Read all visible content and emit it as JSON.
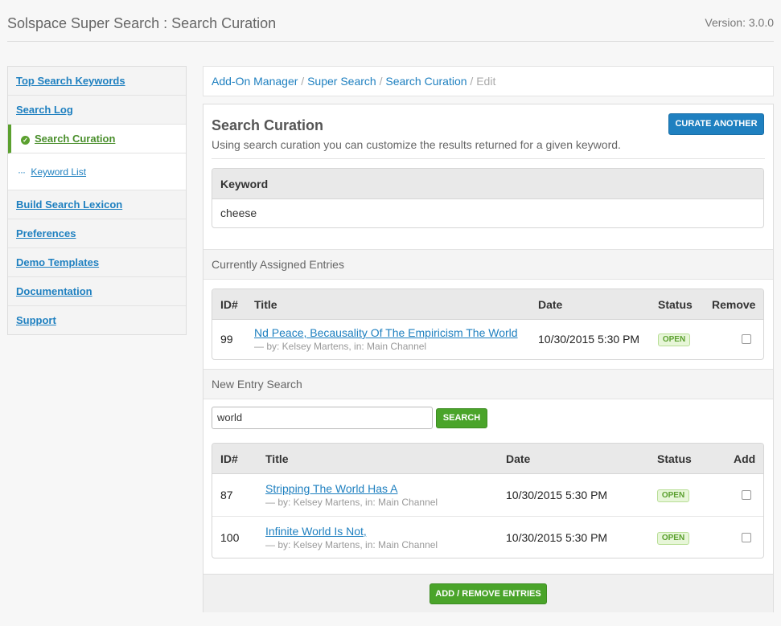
{
  "header": {
    "title": "Solspace Super Search : Search Curation",
    "version": "Version: 3.0.0"
  },
  "sidebar": {
    "items": [
      {
        "label": "Top Search Keywords"
      },
      {
        "label": "Search Log"
      },
      {
        "label": "Search Curation",
        "active": true
      },
      {
        "label": "Keyword List",
        "sub": true
      },
      {
        "label": "Build Search Lexicon"
      },
      {
        "label": "Preferences"
      },
      {
        "label": "Demo Templates"
      },
      {
        "label": "Documentation"
      },
      {
        "label": "Support"
      }
    ]
  },
  "breadcrumb": {
    "items": [
      "Add-On Manager",
      "Super Search",
      "Search Curation"
    ],
    "separator": "/",
    "current": "Edit"
  },
  "main": {
    "title": "Search Curation",
    "description": "Using search curation you can customize the results returned for a given keyword.",
    "curate_another": "CURATE ANOTHER",
    "keyword": {
      "header": "Keyword",
      "value": "cheese"
    },
    "assigned": {
      "section_label": "Currently Assigned Entries",
      "columns": {
        "id": "ID#",
        "title": "Title",
        "date": "Date",
        "status": "Status",
        "action": "Remove"
      },
      "rows": [
        {
          "id": "99",
          "title": "Nd Peace, Becausality Of The Empiricism The World",
          "meta": "— by: Kelsey Martens, in: Main Channel",
          "date": "10/30/2015 5:30 PM",
          "status": "OPEN",
          "checked": false
        }
      ]
    },
    "new_search": {
      "section_label": "New Entry Search",
      "query": "world",
      "button": "SEARCH",
      "columns": {
        "id": "ID#",
        "title": "Title",
        "date": "Date",
        "status": "Status",
        "action": "Add"
      },
      "rows": [
        {
          "id": "87",
          "title": "Stripping The World Has A",
          "meta": "— by: Kelsey Martens, in: Main Channel",
          "date": "10/30/2015 5:30 PM",
          "status": "OPEN",
          "checked": false
        },
        {
          "id": "100",
          "title": "Infinite World Is Not,",
          "meta": "— by: Kelsey Martens, in: Main Channel",
          "date": "10/30/2015 5:30 PM",
          "status": "OPEN",
          "checked": false
        }
      ]
    },
    "submit_button": "ADD / REMOVE ENTRIES"
  },
  "colors": {
    "link": "#1f80c0",
    "primary_button": "#1f80c0",
    "success_button": "#4aa42a",
    "active_accent": "#5ba02f",
    "badge_open_bg": "#e7f6d8"
  },
  "icons": {
    "active_item": "check-circle-icon",
    "sub_item": "ellipsis-icon"
  }
}
